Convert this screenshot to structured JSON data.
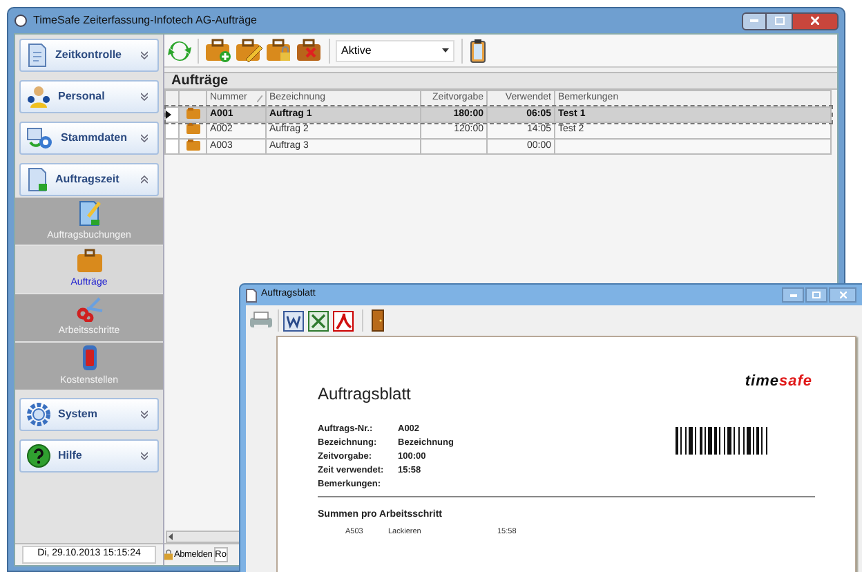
{
  "window": {
    "title": "TimeSafe Zeiterfassung-Infotech AG-Aufträge"
  },
  "sidebar": {
    "groups": [
      {
        "label": "Zeitkontrolle",
        "expanded": false
      },
      {
        "label": "Personal",
        "expanded": false
      },
      {
        "label": "Stammdaten",
        "expanded": false
      },
      {
        "label": "Auftragszeit",
        "expanded": true,
        "items": [
          {
            "label": "Auftragsbuchungen",
            "selected": false
          },
          {
            "label": "Aufträge",
            "selected": true
          },
          {
            "label": "Arbeitsschritte",
            "selected": false
          },
          {
            "label": "Kostenstellen",
            "selected": false
          }
        ]
      },
      {
        "label": "System",
        "expanded": false
      },
      {
        "label": "Hilfe",
        "expanded": false
      }
    ]
  },
  "toolbar": {
    "filter": "Aktive"
  },
  "orders": {
    "title": "Aufträge",
    "columns": [
      "Nummer",
      "Bezeichnung",
      "Zeitvorgabe",
      "Verwendet",
      "Bemerkungen"
    ],
    "rows": [
      {
        "selected": true,
        "cells": [
          "A001",
          "Auftrag 1",
          "180:00",
          "06:05",
          "Test 1"
        ]
      },
      {
        "selected": false,
        "cells": [
          "A002",
          "Auftrag 2",
          "120:00",
          "14:05",
          "Test 2"
        ]
      },
      {
        "selected": false,
        "cells": [
          "A003",
          "Auftrag 3",
          null,
          "00:00",
          null
        ]
      }
    ]
  },
  "status_bar": {
    "datetime": "Di, 29.10.2013 15:15:24",
    "logout": "Abmelden",
    "column_3": "Ro"
  },
  "report_window": {
    "title": "Auftragsblatt",
    "heading": "Auftragsblatt",
    "logo": {
      "dark": "time",
      "accent": "safe"
    },
    "fields": [
      {
        "label": "Auftrags-Nr.:",
        "value": "A002"
      },
      {
        "label": "Bezeichnung:",
        "value": "Bezeichnung"
      },
      {
        "label": "Zeitvorgabe:",
        "value": "100:00"
      },
      {
        "label": "Zeit verwendet:",
        "value": "15:58"
      },
      {
        "label": "Bemerkungen:"
      }
    ],
    "section_title": "Summen pro Arbeitsschritt",
    "steps": [
      {
        "cells": [
          "A503",
          "Lackieren",
          "15:58"
        ]
      }
    ]
  }
}
